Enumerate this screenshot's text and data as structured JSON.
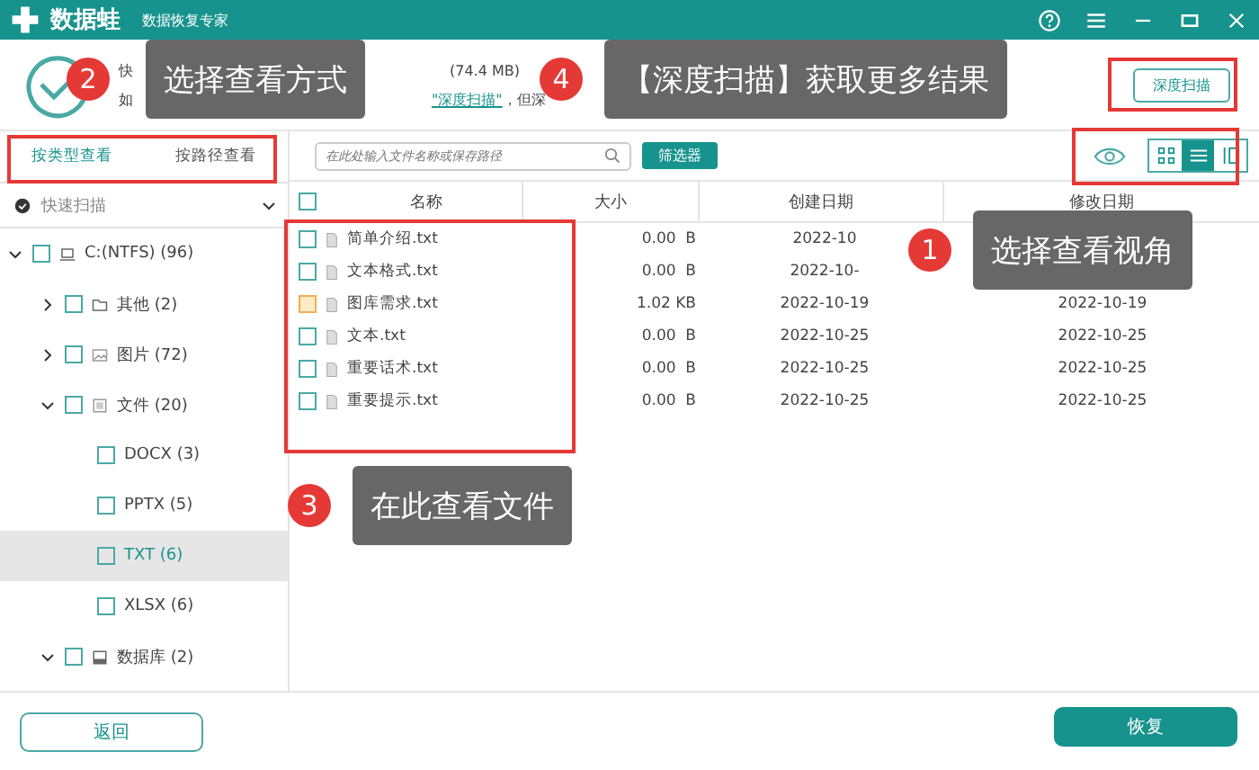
{
  "app": {
    "name": "数据蛙",
    "subtitle": "数据恢复专家"
  },
  "info": {
    "line1": [
      "快",
      "(74.4 MB)"
    ],
    "line2": [
      "如",
      "\"深度扫描\"",
      "，但深"
    ]
  },
  "deep_scan_button": "深度扫描",
  "view_tabs": [
    {
      "label": "按类型查看",
      "selected": true
    },
    {
      "label": "按路径查看",
      "selected": false
    }
  ],
  "search": {
    "placeholder": "在此处输入文件名称或保存路径"
  },
  "filter_button": "筛选器",
  "view_modes": [
    {
      "kind": "grid",
      "selected": false
    },
    {
      "kind": "list",
      "selected": true
    },
    {
      "kind": "panel",
      "selected": false
    }
  ],
  "scan_mode": "快速扫描",
  "tree": [
    {
      "label": "C:(NTFS) (96)",
      "kind": "drive",
      "expanded": true,
      "checked": false,
      "selected": false,
      "children": [
        {
          "label": "其他 (2)",
          "kind": "folder",
          "expanded": false,
          "checked": false,
          "selected": false
        },
        {
          "label": "图片 (72)",
          "kind": "image",
          "expanded": false,
          "checked": false,
          "selected": false
        },
        {
          "label": "文件 (20)",
          "kind": "document",
          "expanded": true,
          "checked": false,
          "selected": false,
          "children": [
            {
              "label": "DOCX (3)",
              "checked": false,
              "selected": false
            },
            {
              "label": "PPTX (5)",
              "checked": false,
              "selected": false
            },
            {
              "label": "TXT (6)",
              "checked": false,
              "selected": true
            },
            {
              "label": "XLSX (6)",
              "checked": false,
              "selected": false
            }
          ]
        },
        {
          "label": "数据库 (2)",
          "kind": "database",
          "expanded": true,
          "checked": false,
          "selected": false
        }
      ]
    }
  ],
  "table": {
    "select_all_checked": false,
    "columns": [
      "名称",
      "大小",
      "创建日期",
      "修改日期"
    ],
    "rows": [
      {
        "name": "简单介绍.txt",
        "size": "0.00  B",
        "created": "2022-10",
        "highlighted": false
      },
      {
        "name": "文本格式.txt",
        "size": "0.00  B",
        "created": "2022-10-",
        "highlighted": false
      },
      {
        "name": "图库需求.txt",
        "size": "1.02 KB",
        "created": "2022-10-19",
        "modified": "2022-10-19",
        "highlighted": true
      },
      {
        "name": "文本.txt",
        "size": "0.00  B",
        "created": "2022-10-25",
        "modified": "2022-10-25",
        "highlighted": false
      },
      {
        "name": "重要话术.txt",
        "size": "0.00  B",
        "created": "2022-10-25",
        "modified": "2022-10-25",
        "highlighted": false
      },
      {
        "name": "重要提示.txt",
        "size": "0.00  B",
        "created": "2022-10-25",
        "modified": "2022-10-25",
        "highlighted": false
      }
    ]
  },
  "callouts": [
    {
      "number": "2",
      "text": "选择查看方式"
    },
    {
      "number": "4",
      "text": "【深度扫描】获取更多结果"
    },
    {
      "number": "1",
      "text": "选择查看视角"
    },
    {
      "number": "3",
      "text": "在此查看文件"
    }
  ],
  "back_button": "返回",
  "recover_button": "恢复"
}
